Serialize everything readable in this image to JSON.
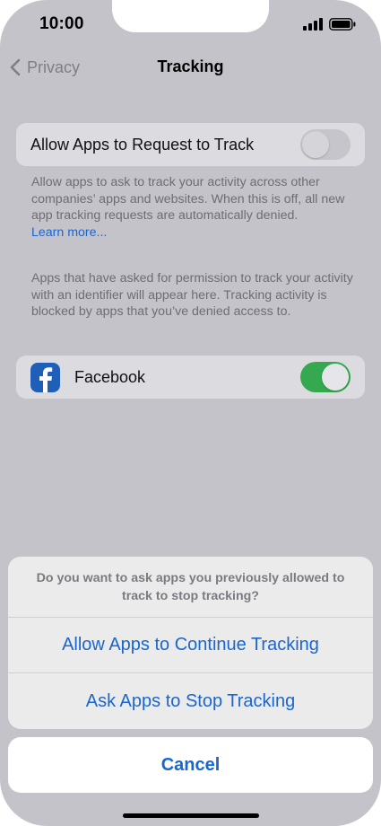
{
  "status_bar": {
    "time": "10:00"
  },
  "nav": {
    "back_label": "Privacy",
    "title": "Tracking"
  },
  "allow_tracking": {
    "label": "Allow Apps to Request to Track",
    "enabled": false
  },
  "allow_footnote": {
    "text": "Allow apps to ask to track your activity across other companies’ apps and websites. When this is off, all new app tracking requests are automatically denied.",
    "link": "Learn more..."
  },
  "apps_footnote": "Apps that have asked for permission to track your activity with an identifier will appear here. Tracking activity is blocked by apps that you’ve denied access to.",
  "apps": [
    {
      "name": "Facebook",
      "icon": "facebook-icon",
      "enabled": true
    }
  ],
  "action_sheet": {
    "message": "Do you want to ask apps you previously allowed to track to stop tracking?",
    "actions": [
      "Allow Apps to Continue Tracking",
      "Ask Apps to Stop Tracking"
    ],
    "cancel": "Cancel"
  },
  "colors": {
    "accent": "#1a66cf",
    "toggle_on": "#34a94f",
    "dimmed_background": "#c4c3c9",
    "facebook_blue": "#1f5fb8"
  }
}
